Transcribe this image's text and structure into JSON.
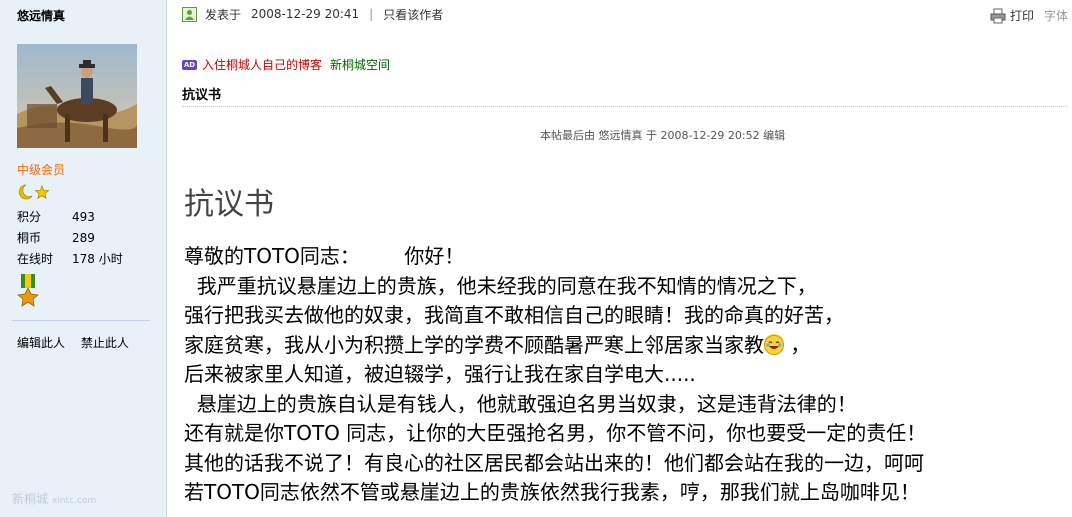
{
  "sidebar": {
    "username": "悠远情真",
    "level": "中级会员",
    "stats": [
      {
        "label": "积分",
        "value": "493"
      },
      {
        "label": "桐币",
        "value": "289"
      },
      {
        "label": "在线时",
        "value": "178 小时"
      }
    ],
    "actions": [
      "编辑此人",
      "禁止此人"
    ],
    "watermark": "新桐城",
    "watermark_url": "xintc.com"
  },
  "post": {
    "posted_label": "发表于",
    "posted_time": "2008-12-29 20:41",
    "only_author": "只看该作者",
    "print_label": "打印",
    "font_label": "字体",
    "ad_link_1": "入住桐城人自己的博客",
    "ad_link_2": "新桐城空间",
    "title": "抗议书",
    "edit_note": "本帖最后由 悠远情真 于 2008-12-29 20:52 编辑",
    "big_title": "抗议书",
    "lines": [
      "尊敬的TOTO同志：       你好！",
      "  我严重抗议悬崖边上的贵族，他未经我的同意在我不知情的情况之下，",
      "强行把我买去做他的奴隶，我简直不敢相信自己的眼睛！我的命真的好苦，",
      "家庭贫寒，我从小为积攒上学的学费不顾酷暑严寒上邻居家当家教",
      "后来被家里人知道，被迫辍学，强行让我在家自学电大.....",
      "  悬崖边上的贵族自认是有钱人，他就敢强迫名男当奴隶，这是违背法律的！",
      "还有就是你TOTO 同志，让你的大臣强抢名男，你不管不问，你也要受一定的责任！",
      "其他的话我不说了！有良心的社区居民都会站出来的！他们都会站在我的一边，呵呵",
      "若TOTO同志依然不管或悬崖边上的贵族依然我行我素，哼，那我们就上岛咖啡见！"
    ],
    "line4_suffix": " ，"
  },
  "colors": {
    "sidebar_bg": "#e8f0f8",
    "level_color": "#ff6600",
    "ad_link_1": "#cc0000",
    "ad_link_2": "#006600"
  }
}
